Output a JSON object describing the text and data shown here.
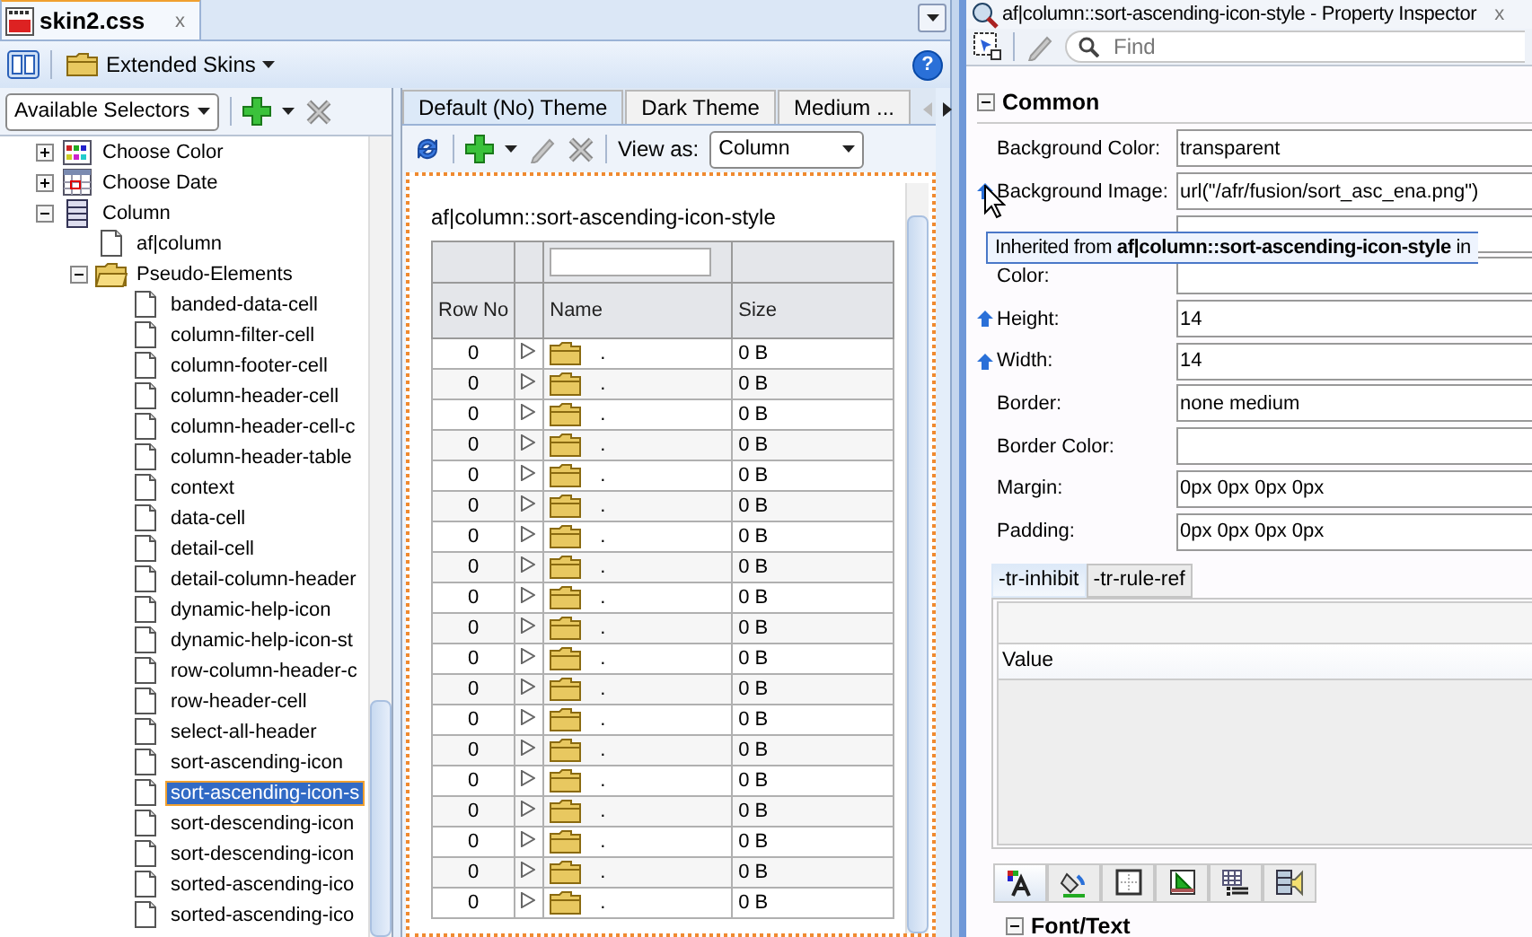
{
  "editor_tab": {
    "title": "skin2.css",
    "close": "x",
    "selected": true
  },
  "skin_toolbar": {
    "skin_menu": "Extended Skins",
    "help": "?"
  },
  "selector_dropdown": "Available Selectors",
  "tree": [
    {
      "label": "Choose Color",
      "kind": "color",
      "expanded": false,
      "selected": false
    },
    {
      "label": "Choose Date",
      "kind": "date",
      "expanded": false,
      "selected": false
    },
    {
      "label": "Column",
      "kind": "column",
      "expanded": true,
      "selected": false,
      "children": [
        {
          "label": "af|column",
          "kind": "file",
          "selected": false
        },
        {
          "label": "Pseudo-Elements",
          "kind": "folder",
          "expanded": true,
          "selected": false,
          "children": [
            {
              "label": "banded-data-cell",
              "kind": "file",
              "selected": false
            },
            {
              "label": "column-filter-cell",
              "kind": "file",
              "selected": false
            },
            {
              "label": "column-footer-cell",
              "kind": "file",
              "selected": false
            },
            {
              "label": "column-header-cell",
              "kind": "file",
              "selected": false
            },
            {
              "label": "column-header-cell-c",
              "kind": "file",
              "selected": false
            },
            {
              "label": "column-header-table",
              "kind": "file",
              "selected": false
            },
            {
              "label": "context",
              "kind": "file",
              "selected": false
            },
            {
              "label": "data-cell",
              "kind": "file",
              "selected": false
            },
            {
              "label": "detail-cell",
              "kind": "file",
              "selected": false
            },
            {
              "label": "detail-column-header",
              "kind": "file",
              "selected": false
            },
            {
              "label": "dynamic-help-icon",
              "kind": "file",
              "selected": false
            },
            {
              "label": "dynamic-help-icon-st",
              "kind": "file",
              "selected": false
            },
            {
              "label": "row-column-header-c",
              "kind": "file",
              "selected": false
            },
            {
              "label": "row-header-cell",
              "kind": "file",
              "selected": false
            },
            {
              "label": "select-all-header",
              "kind": "file",
              "selected": false
            },
            {
              "label": "sort-ascending-icon",
              "kind": "file",
              "selected": false
            },
            {
              "label": "sort-ascending-icon-s",
              "kind": "file",
              "selected": true
            },
            {
              "label": "sort-descending-icon",
              "kind": "file",
              "selected": false
            },
            {
              "label": "sort-descending-icon",
              "kind": "file",
              "selected": false
            },
            {
              "label": "sorted-ascending-ico",
              "kind": "file",
              "selected": false
            },
            {
              "label": "sorted-ascending-ico",
              "kind": "file",
              "selected": false
            }
          ]
        }
      ]
    }
  ],
  "theme_tabs": [
    {
      "label": "Default (No) Theme",
      "selected": true
    },
    {
      "label": "Dark Theme",
      "selected": false
    },
    {
      "label": "Medium ...",
      "selected": false
    }
  ],
  "preview_toolbar": {
    "view_as_label": "View as:",
    "view_as_value": "Column"
  },
  "preview": {
    "title": "af|column::sort-ascending-icon-style",
    "columns": [
      "Row No",
      "Name",
      "Size"
    ],
    "rows": [
      {
        "row_no": "0",
        "name": ".",
        "size": "0 B"
      },
      {
        "row_no": "0",
        "name": ".",
        "size": "0 B"
      },
      {
        "row_no": "0",
        "name": ".",
        "size": "0 B"
      },
      {
        "row_no": "0",
        "name": ".",
        "size": "0 B"
      },
      {
        "row_no": "0",
        "name": ".",
        "size": "0 B"
      },
      {
        "row_no": "0",
        "name": ".",
        "size": "0 B"
      },
      {
        "row_no": "0",
        "name": ".",
        "size": "0 B"
      },
      {
        "row_no": "0",
        "name": ".",
        "size": "0 B"
      },
      {
        "row_no": "0",
        "name": ".",
        "size": "0 B"
      },
      {
        "row_no": "0",
        "name": ".",
        "size": "0 B"
      },
      {
        "row_no": "0",
        "name": ".",
        "size": "0 B"
      },
      {
        "row_no": "0",
        "name": ".",
        "size": "0 B"
      },
      {
        "row_no": "0",
        "name": ".",
        "size": "0 B"
      },
      {
        "row_no": "0",
        "name": ".",
        "size": "0 B"
      },
      {
        "row_no": "0",
        "name": ".",
        "size": "0 B"
      },
      {
        "row_no": "0",
        "name": ".",
        "size": "0 B"
      },
      {
        "row_no": "0",
        "name": ".",
        "size": "0 B"
      },
      {
        "row_no": "0",
        "name": ".",
        "size": "0 B"
      },
      {
        "row_no": "0",
        "name": ".",
        "size": "0 B"
      }
    ]
  },
  "inspector": {
    "title": "af|column::sort-ascending-icon-style - Property Inspector",
    "close": "x",
    "find_placeholder": "Find",
    "section": {
      "label": "Common",
      "expanded": true
    },
    "properties": [
      {
        "label": "Background Color:",
        "value": "transparent",
        "inherited": false
      },
      {
        "label": "Background Image:",
        "value": "url(\"/afr/fusion/sort_asc_ena.png\")",
        "inherited": true
      },
      {
        "inherited": false
      },
      {
        "label": "Color:",
        "inherited": false
      },
      {
        "label": "Height:",
        "value": "14",
        "inherited": true
      },
      {
        "label": "Width:",
        "value": "14",
        "inherited": true
      },
      {
        "label": "Border:",
        "value": "none medium",
        "inherited": false
      },
      {
        "label": "Border Color:",
        "inherited": false
      },
      {
        "label": "Margin:",
        "value": "0px 0px 0px 0px",
        "inherited": false
      },
      {
        "label": "Padding:",
        "value": "0px 0px 0px 0px",
        "inherited": false
      }
    ],
    "tooltip": "Inherited from **af|column::sort-ascending-icon-style** in",
    "rule_tabs": [
      {
        "label": "-tr-inhibit",
        "selected": true
      },
      {
        "label": "-tr-rule-ref",
        "selected": false
      }
    ],
    "value_header": "Value",
    "style_tabs": [
      {
        "kind": "font",
        "selected": true
      },
      {
        "kind": "background",
        "selected": false
      },
      {
        "kind": "box",
        "selected": false
      },
      {
        "kind": "position",
        "selected": false
      },
      {
        "kind": "list",
        "selected": false
      },
      {
        "kind": "media",
        "selected": false
      }
    ],
    "section2": {
      "label": "Font/Text",
      "expanded": true
    }
  }
}
